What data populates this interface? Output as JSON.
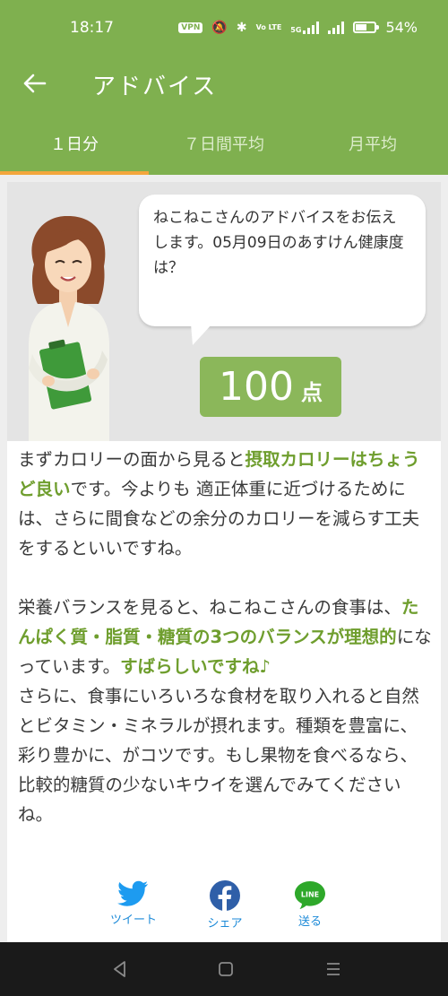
{
  "status_bar": {
    "time": "18:17",
    "vpn": "VPN",
    "volte": "Vo LTE",
    "network": "5G",
    "battery": "54%",
    "battery_level": 0.54
  },
  "header": {
    "title": "アドバイス",
    "back_icon": "arrow-left-icon"
  },
  "tabs": [
    {
      "label": "１日分",
      "active": true
    },
    {
      "label": "７日間平均",
      "active": false
    },
    {
      "label": "月平均",
      "active": false
    }
  ],
  "bubble": {
    "text": "ねこねこさんのアドバイスをお伝えします。05月09日のあすけん健康度は？"
  },
  "score": {
    "value": "100",
    "unit": "点"
  },
  "advice": {
    "p1": [
      {
        "t": "まずカロリーの面から見ると",
        "hl": false
      },
      {
        "t": "摂取カロリーはちょうど良い",
        "hl": true
      },
      {
        "t": "です。今よりも 適正体重に近づけるためには、さらに間食などの余分のカロリーを減らす工夫をするといいですね。",
        "hl": false
      }
    ],
    "p2": [
      {
        "t": "栄養バランスを見ると、ねこねこさんの食事は、",
        "hl": false
      },
      {
        "t": "たんぱく質・脂質・糖質の3つのバランスが理想的",
        "hl": true
      },
      {
        "t": "になっています。",
        "hl": false
      },
      {
        "t": "すばらしいですね♪",
        "hl": true
      }
    ],
    "p3": [
      {
        "t": "さらに、食事にいろいろな食材を取り入れると自然とビタミン・ミネラルが摂れます。種類を豊富に、彩り豊かに、がコツです。もし果物を食べるなら、比較的糖質の少ないキウイを選んでみてくださいね。",
        "hl": false
      }
    ]
  },
  "share": {
    "tweet": "ツイート",
    "facebook": "シェア",
    "line": "送る",
    "line_logo": "LINE"
  },
  "colors": {
    "brand_green": "#7fb04f",
    "highlight_green": "#6f9e2e",
    "tab_indicator": "#f3a63c",
    "link_blue": "#1c8ad8"
  }
}
